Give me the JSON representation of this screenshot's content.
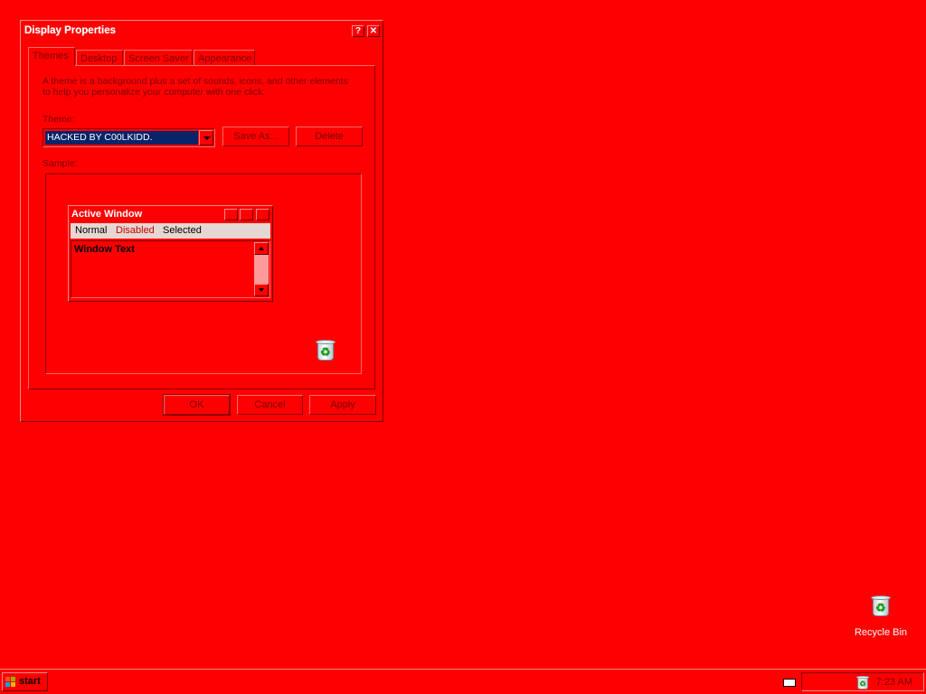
{
  "dialog": {
    "title": "Display Properties",
    "help_glyph": "?",
    "close_glyph": "✕",
    "tabs": [
      {
        "label": "Themes",
        "active": true
      },
      {
        "label": "Desktop"
      },
      {
        "label": "Screen Saver"
      },
      {
        "label": "Appearance"
      }
    ],
    "description_line1": "A theme is a background plus a set of sounds, icons, and other elements",
    "description_line2": "to help you personalize your computer with one click.",
    "theme_label": "Theme:",
    "theme_value": "HACKED BY C00LKIDD.",
    "save_as_label": "Save As...",
    "delete_label": "Delete",
    "sample_label": "Sample:",
    "buttons": {
      "ok": "OK",
      "cancel": "Cancel",
      "apply": "Apply"
    }
  },
  "sample_window": {
    "title": "Active Window",
    "menu": {
      "normal": "Normal",
      "disabled": "Disabled",
      "selected": "Selected"
    },
    "window_text": "Window Text"
  },
  "desktop": {
    "recycle_bin_label": "Recycle Bin",
    "background_color": "#fe0000"
  },
  "taskbar": {
    "start_label": "start",
    "clock": "7:23 AM"
  }
}
